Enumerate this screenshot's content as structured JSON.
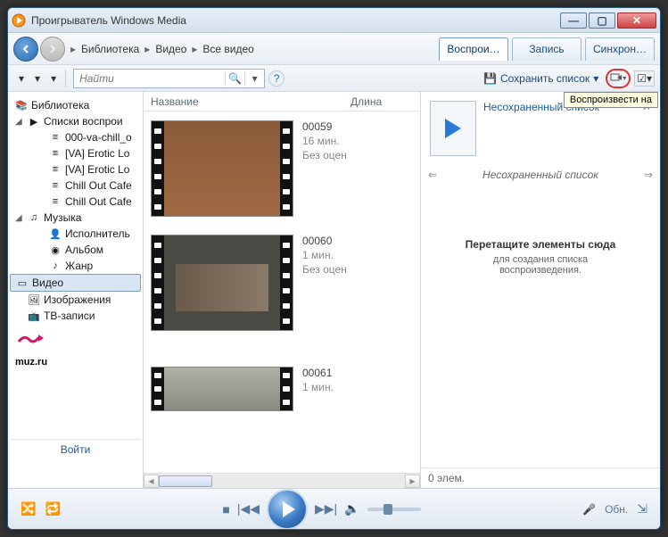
{
  "title": "Проигрыватель Windows Media",
  "breadcrumb": {
    "a": "Библиотека",
    "b": "Видео",
    "c": "Все видео"
  },
  "tabs": {
    "play": "Воспрои…",
    "burn": "Запись",
    "sync": "Синхрон…"
  },
  "toolbar": {
    "search_placeholder": "Найти",
    "save_list": "Сохранить список",
    "tooltip": "Воспроизвести на"
  },
  "tree": {
    "library": "Библиотека",
    "playlists": "Списки воспрои",
    "pl1": "000-va-chill_o",
    "pl2": "[VA] Erotic Lo",
    "pl3": "[VA] Erotic Lo",
    "pl4": "Chill Out Cafe",
    "pl5": "Chill Out Cafe",
    "music": "Музыка",
    "artist": "Исполнитель",
    "album": "Альбом",
    "genre": "Жанр",
    "video": "Видео",
    "images": "Изображения",
    "tv": "ТВ-записи",
    "logo": "muz.ru",
    "login": "Войти"
  },
  "columns": {
    "name": "Название",
    "length": "Длина"
  },
  "videos": [
    {
      "name": "00059",
      "dur": "16 мин.",
      "rating": "Без оцен",
      "bg": "linear-gradient(#8a5a3a,#a06a44)"
    },
    {
      "name": "00060",
      "dur": "1 мин.",
      "rating": "Без оцен",
      "bg": "linear-gradient(135deg,#2a3a4a,#5a4a3a)"
    },
    {
      "name": "00061",
      "dur": "1 мин.",
      "rating": "",
      "bg": "linear-gradient(#b0b0a8,#8a8a80)"
    }
  ],
  "panel": {
    "unsaved_link": "Несохраненный список",
    "unsaved_head": "Несохраненный список",
    "drop_title": "Перетащите элементы сюда",
    "drop_sub1": "для создания списка",
    "drop_sub2": "воспроизведения.",
    "count": "0 элем."
  },
  "player": {
    "refresh": "Обн."
  }
}
